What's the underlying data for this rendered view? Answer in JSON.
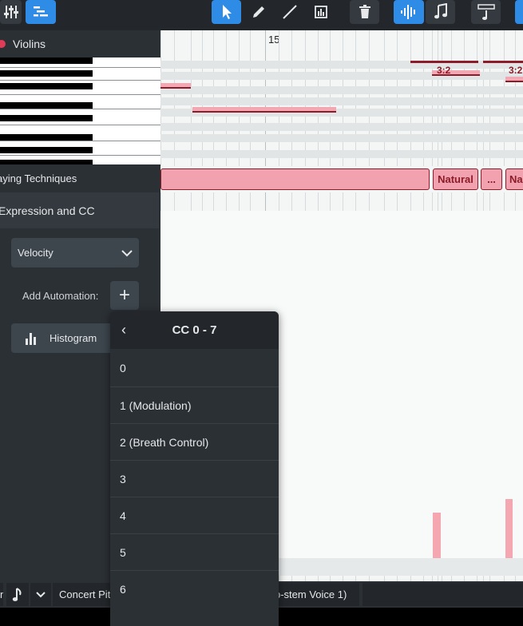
{
  "toolbar": {
    "buttons": [
      {
        "name": "mixer-icon",
        "active": false
      },
      {
        "name": "piano-roll-icon",
        "active": true
      },
      {
        "name": "select-tool-icon",
        "active": true
      },
      {
        "name": "pencil-tool-icon",
        "active": false
      },
      {
        "name": "line-tool-icon",
        "active": false
      },
      {
        "name": "resize-tool-icon",
        "active": false
      },
      {
        "name": "delete-icon",
        "active": false
      },
      {
        "name": "audio-wave-icon",
        "active": true
      },
      {
        "name": "music-note-icon",
        "active": false
      },
      {
        "name": "ruler-note-icon",
        "active": false
      }
    ]
  },
  "track": {
    "name": "Violins",
    "color": "#e03c57"
  },
  "left_panel": {
    "playing_techniques": "aying Techniques",
    "expression": "Expression and CC",
    "velocity_label": "Velocity",
    "add_automation": "Add Automation:",
    "add_symbol": "+",
    "histogram": "Histogram"
  },
  "roll": {
    "bar_number": "15",
    "tuplets": [
      "3:2",
      "3:2"
    ],
    "techniques": [
      "Natural",
      "...",
      "Na"
    ]
  },
  "popup": {
    "back": "‹",
    "title": "CC 0 - 7",
    "items": [
      "0",
      "1 (Modulation)",
      "2 (Breath Control)",
      "3",
      "4",
      "5",
      "6"
    ]
  },
  "status": {
    "first": "n",
    "pitch": "Concert Pit",
    "voice": "p-stem Voice 1)"
  },
  "colors": {
    "accent": "#2e8be6",
    "note": "#f2a8b2",
    "note_border": "#8c1c2a"
  }
}
